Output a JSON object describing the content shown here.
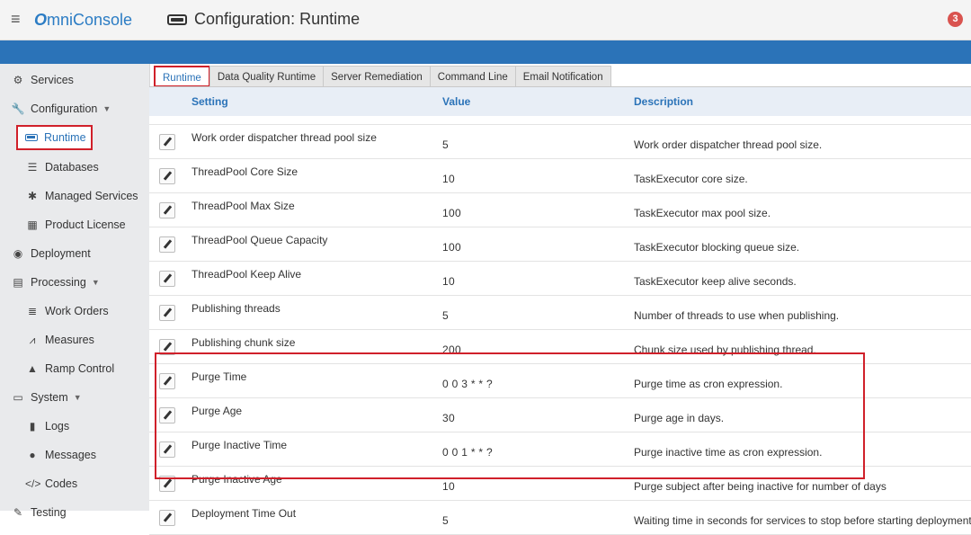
{
  "app": {
    "menu_icon": "hamburger-icon",
    "brand_initial": "O",
    "brand_rest": "mniConsole",
    "title": "Configuration: Runtime",
    "notification_count": "3"
  },
  "sidebar": {
    "items": [
      {
        "label": "Services",
        "icon": "cogs-icon"
      },
      {
        "label": "Configuration",
        "icon": "wrench-icon"
      },
      {
        "label": "Runtime",
        "icon": "runtime-icon"
      },
      {
        "label": "Databases",
        "icon": "database-icon"
      },
      {
        "label": "Managed Services",
        "icon": "gear-icon"
      },
      {
        "label": "Product License",
        "icon": "license-icon"
      },
      {
        "label": "Deployment",
        "icon": "deployment-icon"
      },
      {
        "label": "Processing",
        "icon": "processing-icon"
      },
      {
        "label": "Work Orders",
        "icon": "list-icon"
      },
      {
        "label": "Measures",
        "icon": "chart-icon"
      },
      {
        "label": "Ramp Control",
        "icon": "ramp-icon"
      },
      {
        "label": "System",
        "icon": "monitor-icon"
      },
      {
        "label": "Logs",
        "icon": "file-icon"
      },
      {
        "label": "Messages",
        "icon": "messages-icon"
      },
      {
        "label": "Codes",
        "icon": "code-icon"
      },
      {
        "label": "Testing",
        "icon": "testing-icon"
      }
    ]
  },
  "tabs": [
    "Runtime",
    "Data Quality Runtime",
    "Server Remediation",
    "Command Line",
    "Email Notification"
  ],
  "table": {
    "headers": {
      "setting": "Setting",
      "value": "Value",
      "description": "Description"
    },
    "rows": [
      {
        "setting": "Work order dispatcher thread pool size",
        "value": "5",
        "description": "Work order dispatcher thread pool size."
      },
      {
        "setting": "ThreadPool Core Size",
        "value": "10",
        "description": "TaskExecutor core size."
      },
      {
        "setting": "ThreadPool Max Size",
        "value": "100",
        "description": "TaskExecutor max pool size."
      },
      {
        "setting": "ThreadPool Queue Capacity",
        "value": "100",
        "description": "TaskExecutor blocking queue size."
      },
      {
        "setting": "ThreadPool Keep Alive",
        "value": "10",
        "description": "TaskExecutor keep alive seconds."
      },
      {
        "setting": "Publishing threads",
        "value": "5",
        "description": "Number of threads to use when publishing."
      },
      {
        "setting": "Publishing chunk size",
        "value": "200",
        "description": "Chunk size used by publishing thread."
      },
      {
        "setting": "Purge Time",
        "value": "0 0 3 * * ?",
        "description": "Purge time as cron expression."
      },
      {
        "setting": "Purge Age",
        "value": "30",
        "description": "Purge age in days."
      },
      {
        "setting": "Purge Inactive Time",
        "value": "0 0 1 * * ?",
        "description": "Purge inactive time as cron expression."
      },
      {
        "setting": "Purge Inactive Age",
        "value": "10",
        "description": "Purge subject after being inactive for number of days"
      },
      {
        "setting": "Deployment Time Out",
        "value": "5",
        "description": "Waiting time in seconds for services to stop before starting deployment process."
      }
    ]
  },
  "colors": {
    "accent": "#2b73b8",
    "highlight": "#d0202a",
    "badge": "#d9534f"
  }
}
